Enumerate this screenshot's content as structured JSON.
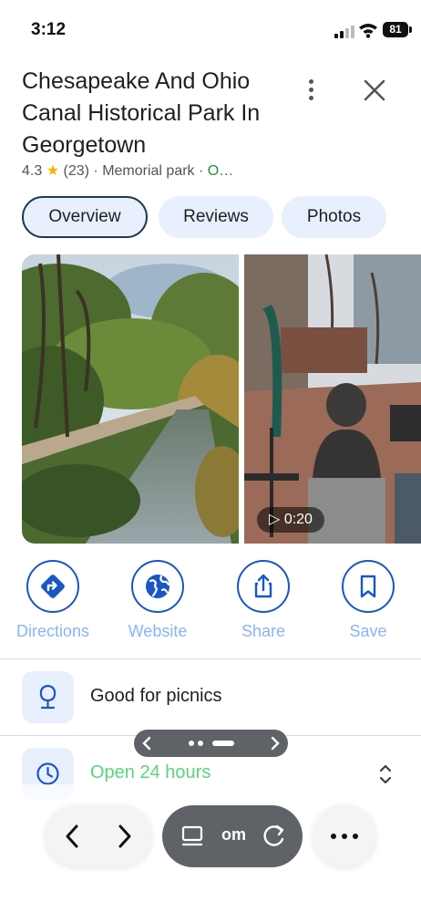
{
  "status_bar": {
    "time": "3:12",
    "battery": "81"
  },
  "place": {
    "name": "Chesapeake And Ohio Canal Historical Park In Georgetown",
    "rating": "4.3",
    "review_count": "(23)",
    "category": "Memorial park",
    "hours_status": "O…"
  },
  "tabs": [
    {
      "label": "Overview",
      "active": true
    },
    {
      "label": "Reviews",
      "active": false
    },
    {
      "label": "Photos",
      "active": false
    }
  ],
  "media": {
    "video_duration": "0:20"
  },
  "actions": [
    {
      "label": "Directions",
      "icon": "directions-icon"
    },
    {
      "label": "Website",
      "icon": "globe-icon"
    },
    {
      "label": "Share",
      "icon": "share-icon"
    },
    {
      "label": "Save",
      "icon": "bookmark-icon"
    }
  ],
  "info_rows": {
    "amenity": "Good for picnics",
    "hours": "Open 24 hours"
  },
  "browser": {
    "url_fragment": "om"
  },
  "colors": {
    "accent_blue": "#1a56c4",
    "action_label": "#8ab4f8",
    "open_green": "#5dd17b",
    "chip_bg": "#e8f0fe",
    "star": "#f4b400"
  }
}
